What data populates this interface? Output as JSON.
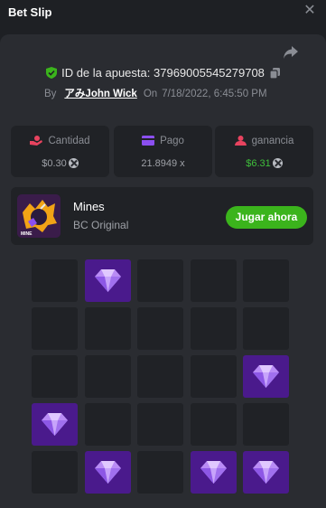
{
  "header": {
    "title": "Bet Slip",
    "close_icon": "close-icon"
  },
  "bet": {
    "id_label": "ID de la apuesta:",
    "id_value": "37969005545279708",
    "by_label": "By",
    "user": "アみJohn Wick",
    "on_label": "On",
    "date": "7/18/2022, 6:45:50 PM"
  },
  "stats": {
    "amount": {
      "label": "Cantidad",
      "value": "$0.30",
      "icon": "coins-hand-icon"
    },
    "payout": {
      "label": "Pago",
      "value": "21.8949 x",
      "icon": "wallet-icon"
    },
    "profit": {
      "label": "ganancia",
      "value": "$6.31",
      "icon": "profit-person-icon"
    }
  },
  "game": {
    "name": "Mines",
    "provider": "BC Original",
    "play_label": "Jugar ahora",
    "thumb_text": "MINE"
  },
  "colors": {
    "background": "#1e2024",
    "panel": "#2a2c31",
    "card": "#202226",
    "tile": "#202226",
    "gem_tile": "#4a1a8c",
    "accent_green": "#3bb41c",
    "profit_green": "#3fbf3b",
    "amount_icon": "#e8435f",
    "payout_icon": "#8b4ff0",
    "profit_icon": "#e8435f"
  },
  "mines_grid": [
    [
      0,
      1,
      0,
      0,
      0
    ],
    [
      0,
      0,
      0,
      0,
      0
    ],
    [
      0,
      0,
      0,
      0,
      1
    ],
    [
      1,
      0,
      0,
      0,
      0
    ],
    [
      0,
      1,
      0,
      1,
      1
    ]
  ]
}
